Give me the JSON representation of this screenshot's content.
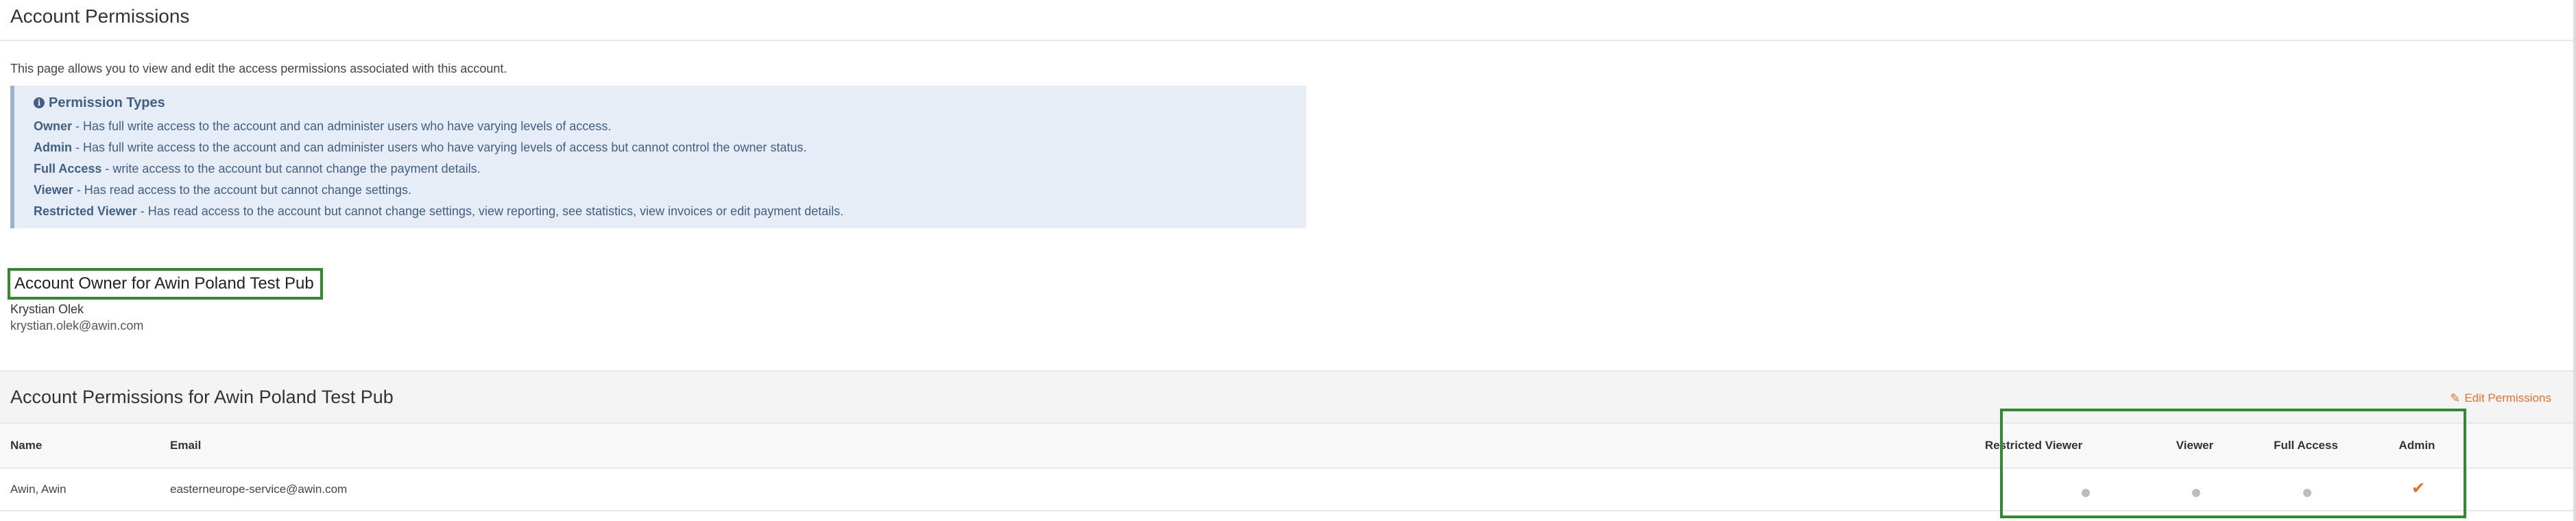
{
  "page": {
    "title": "Account Permissions",
    "intro": "This page allows you to view and edit the access permissions associated with this account."
  },
  "info": {
    "icon": "info-circle-icon",
    "title": "Permission Types",
    "items": [
      {
        "term": "Owner",
        "desc": " - Has full write access to the account and can administer users who have varying levels of access."
      },
      {
        "term": "Admin",
        "desc": " - Has full write access to the account and can administer users who have varying levels of access but cannot control the owner status."
      },
      {
        "term": "Full Access",
        "desc": " - write access to the account but cannot change the payment details."
      },
      {
        "term": "Viewer",
        "desc": " - Has read access to the account but cannot change settings."
      },
      {
        "term": "Restricted Viewer",
        "desc": " - Has read access to the account but cannot change settings, view reporting, see statistics, view invoices or edit payment details."
      }
    ]
  },
  "owner": {
    "title": "Account Owner for Awin Poland Test Pub",
    "name": "Krystian Olek",
    "email": "krystian.olek@awin.com"
  },
  "permissions": {
    "heading": "Account Permissions for Awin Poland Test Pub",
    "edit_label": "Edit Permissions",
    "edit_icon": "pencil-icon",
    "columns": {
      "name": "Name",
      "email": "Email",
      "restricted_viewer": "Restricted Viewer",
      "viewer": "Viewer",
      "full_access": "Full Access",
      "admin": "Admin"
    },
    "rows": [
      {
        "name": "Awin, Awin",
        "email": "easterneurope-service@awin.com",
        "restricted_viewer": false,
        "viewer": false,
        "full_access": false,
        "admin": true
      }
    ]
  },
  "colors": {
    "accent": "#e8702a",
    "info_text": "#3f5f86",
    "info_bg": "#e7edf6",
    "highlight": "#2e8b2e",
    "inactive_dot": "#bdbdbd"
  }
}
